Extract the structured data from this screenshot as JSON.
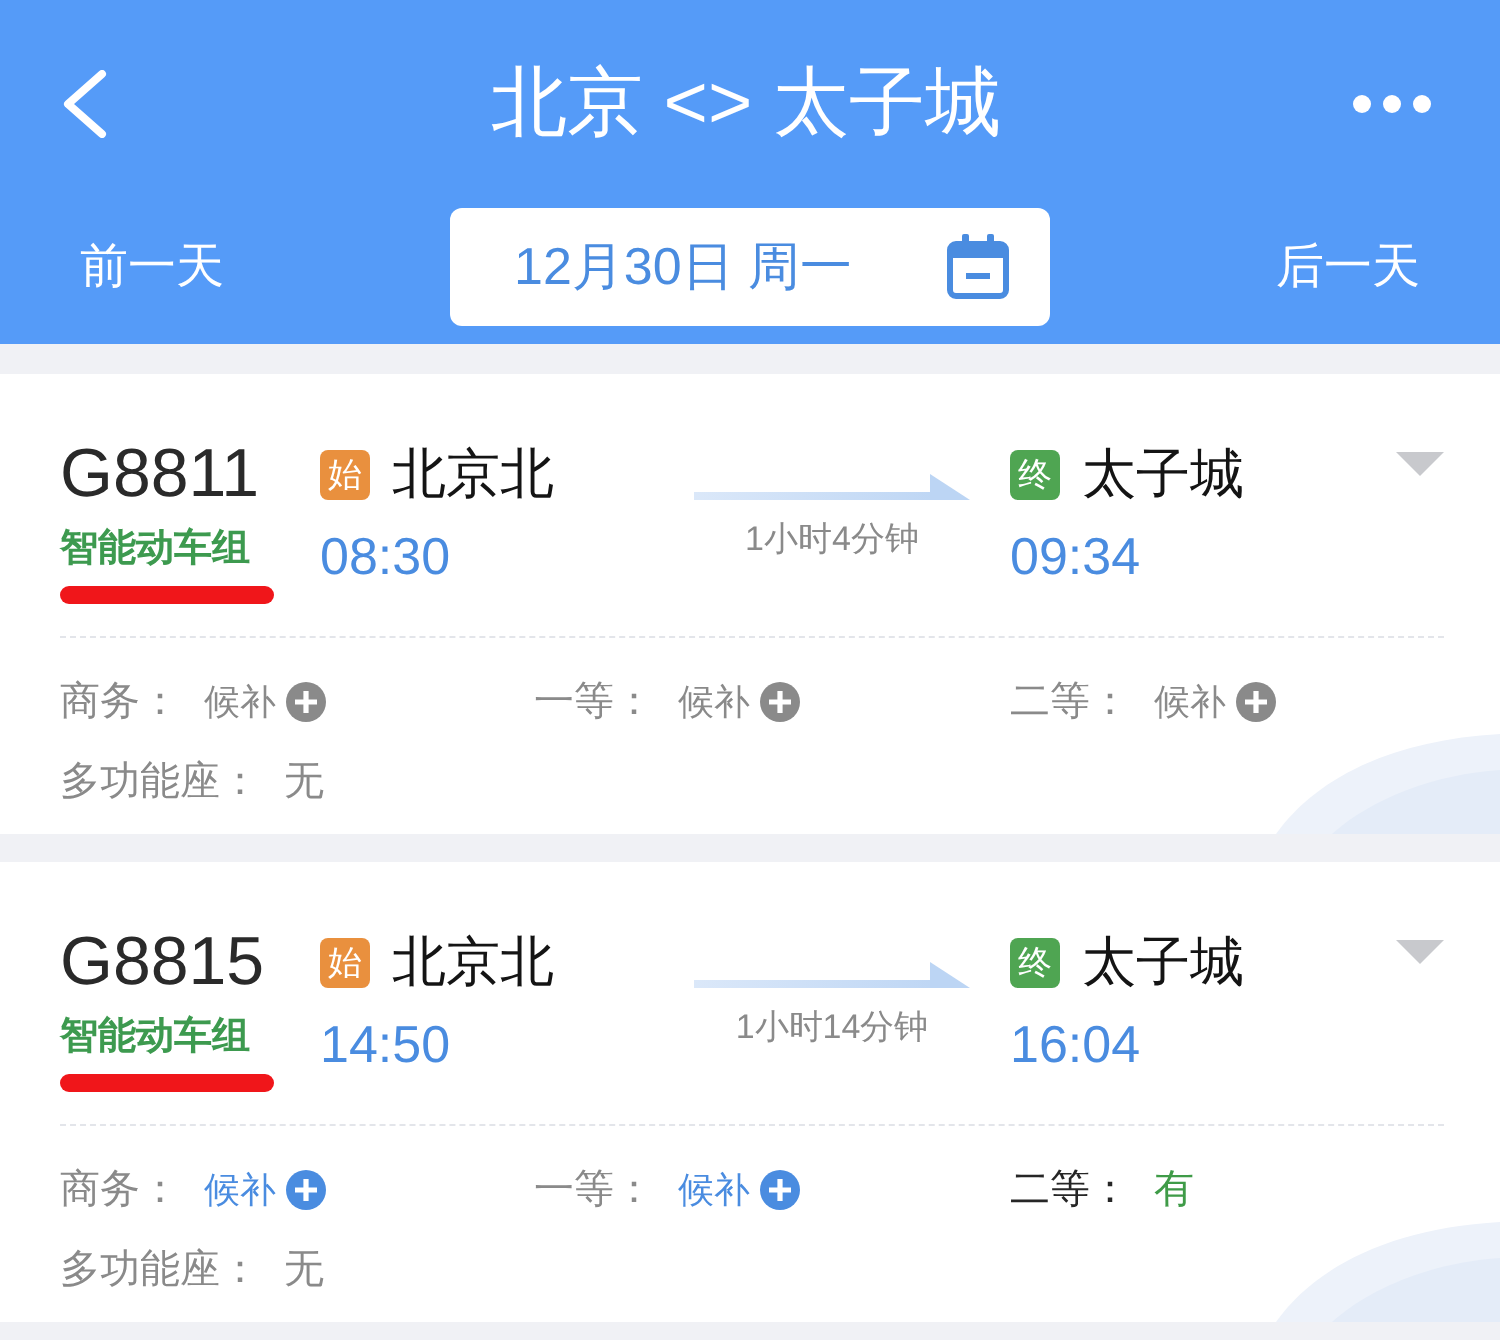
{
  "header": {
    "title": "北京 <> 太子城",
    "previous_day": "前一天",
    "date": "12月30日 周一",
    "next_day": "后一天"
  },
  "trains": [
    {
      "number": "G8811",
      "train_type": "智能动车组",
      "underlined": true,
      "from": {
        "badge": "始",
        "station": "北京北",
        "time": "08:30"
      },
      "duration": "1小时4分钟",
      "to": {
        "badge": "终",
        "station": "太子城",
        "time": "09:34"
      },
      "seats": [
        {
          "kind": "waitlist",
          "label": "商务：",
          "value": "候补",
          "disabled": true
        },
        {
          "kind": "waitlist",
          "label": "一等：",
          "value": "候补",
          "disabled": true
        },
        {
          "kind": "waitlist",
          "label": "二等：",
          "value": "候补",
          "disabled": true
        },
        {
          "kind": "none",
          "label": "多功能座：",
          "value": "无",
          "disabled": true
        }
      ]
    },
    {
      "number": "G8815",
      "train_type": "智能动车组",
      "underlined": true,
      "from": {
        "badge": "始",
        "station": "北京北",
        "time": "14:50"
      },
      "duration": "1小时14分钟",
      "to": {
        "badge": "终",
        "station": "太子城",
        "time": "16:04"
      },
      "seats": [
        {
          "kind": "waitlist",
          "label": "商务：",
          "value": "候补",
          "disabled": false
        },
        {
          "kind": "waitlist",
          "label": "一等：",
          "value": "候补",
          "disabled": false
        },
        {
          "kind": "available",
          "label": "二等：",
          "value": "有",
          "disabled": false
        },
        {
          "kind": "none",
          "label": "多功能座：",
          "value": "无",
          "disabled": true
        }
      ]
    }
  ]
}
